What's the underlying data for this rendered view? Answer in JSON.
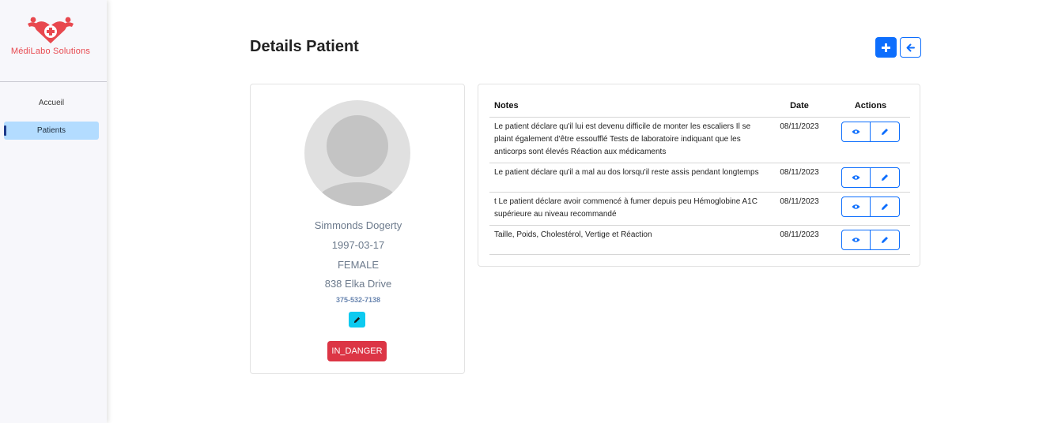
{
  "brand": {
    "name": "MédiLabo Solutions",
    "logo_color": "#e8484e"
  },
  "sidebar": {
    "items": [
      {
        "label": "Accueil",
        "active": false
      },
      {
        "label": "Patients",
        "active": true
      }
    ]
  },
  "header": {
    "title": "Details Patient",
    "add_icon": "plus-icon",
    "back_icon": "arrow-left-icon"
  },
  "patient": {
    "name": "Simmonds Dogerty",
    "dob": "1997-03-17",
    "gender": "FEMALE",
    "address": "838 Elka Drive",
    "phone": "375-532-7138",
    "status": "IN_DANGER",
    "edit_icon": "pencil-icon"
  },
  "notes": {
    "headers": {
      "note": "Notes",
      "date": "Date",
      "actions": "Actions"
    },
    "rows": [
      {
        "text": "Le patient déclare qu'il lui est devenu difficile de monter les escaliers Il se plaint également d'être essoufflé Tests de laboratoire indiquant que les anticorps sont élevés Réaction aux médicaments",
        "date": "08/11/2023"
      },
      {
        "text": "Le patient déclare qu'il a mal au dos lorsqu'il reste assis pendant longtemps",
        "date": "08/11/2023"
      },
      {
        "text": "t Le patient déclare avoir commencé à fumer depuis peu Hémoglobine A1C supérieure au niveau recommandé",
        "date": "08/11/2023"
      },
      {
        "text": "Taille, Poids, Cholestérol, Vertige et Réaction",
        "date": "08/11/2023"
      }
    ]
  },
  "colors": {
    "primary": "#0d6efd",
    "info": "#0dcaf0",
    "danger": "#dc3545",
    "sidebar_active": "#b3dcff"
  }
}
